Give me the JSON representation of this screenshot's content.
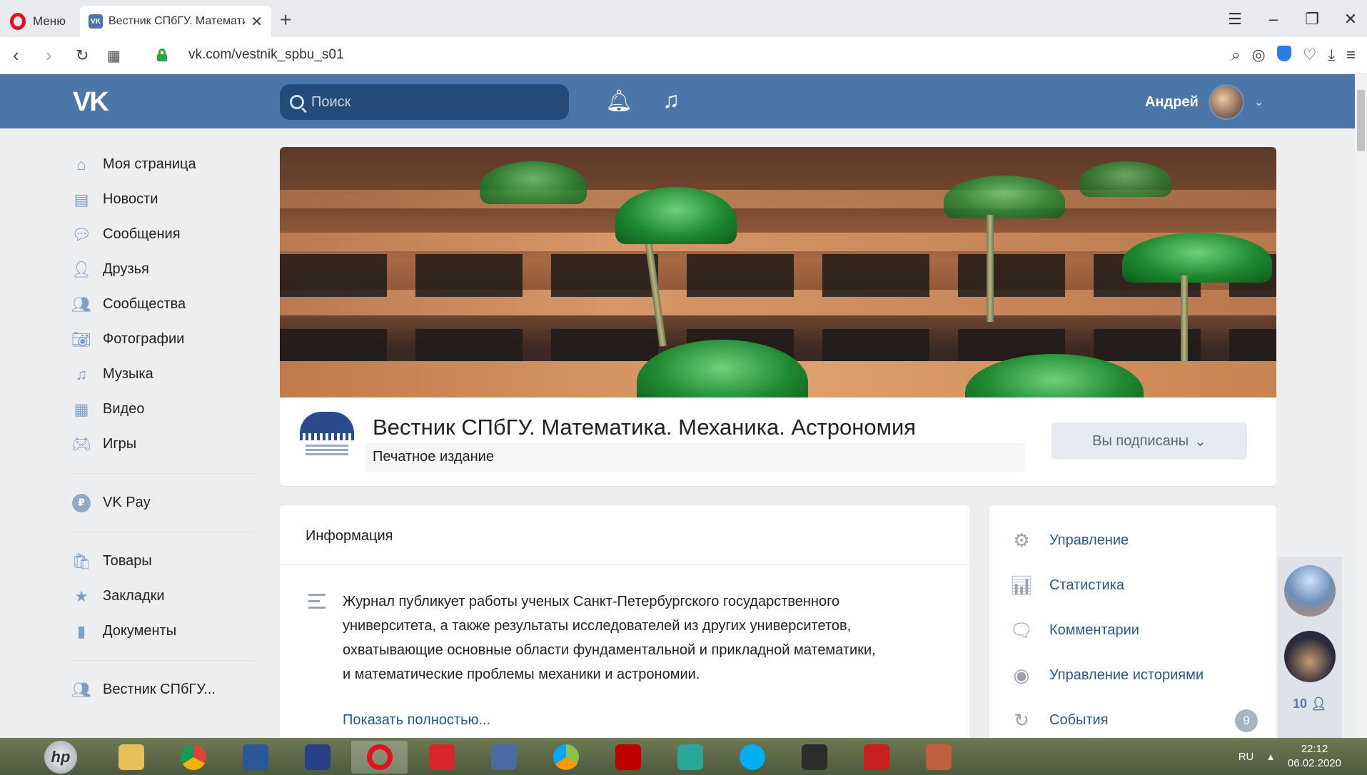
{
  "browser": {
    "menu_label": "Меню",
    "tab_title": "Вестник СПбГУ. Математи",
    "url": "vk.com/vestnik_spbu_s01"
  },
  "header": {
    "search_placeholder": "Поиск",
    "user_name": "Андрей"
  },
  "sidebar": {
    "items": [
      {
        "label": "Моя страница",
        "icon": "home-icon"
      },
      {
        "label": "Новости",
        "icon": "news-icon"
      },
      {
        "label": "Сообщения",
        "icon": "messages-icon"
      },
      {
        "label": "Друзья",
        "icon": "friends-icon"
      },
      {
        "label": "Сообщества",
        "icon": "communities-icon"
      },
      {
        "label": "Фотографии",
        "icon": "photos-icon"
      },
      {
        "label": "Музыка",
        "icon": "music-icon"
      },
      {
        "label": "Видео",
        "icon": "video-icon"
      },
      {
        "label": "Игры",
        "icon": "games-icon"
      },
      {
        "label": "VK Pay",
        "icon": "vkpay-icon"
      },
      {
        "label": "Товары",
        "icon": "goods-icon"
      },
      {
        "label": "Закладки",
        "icon": "bookmarks-icon"
      },
      {
        "label": "Документы",
        "icon": "documents-icon"
      },
      {
        "label": "Вестник СПбГУ...",
        "icon": "group-icon"
      }
    ]
  },
  "group": {
    "title": "Вестник СПбГУ. Математика. Механика. Астрономия",
    "status": "Печатное издание",
    "subscribe_label": "Вы подписаны"
  },
  "info": {
    "heading": "Информация",
    "description": "Журнал публикует работы ученых Санкт-Петербургского государственного университета, а также результаты исследователей из других университетов, охватывающие основные области фундаментальной и прикладной математики, и математические проблемы механики и астрономии.",
    "show_more": "Показать полностью..."
  },
  "management": {
    "items": [
      {
        "label": "Управление",
        "icon": "gear-icon"
      },
      {
        "label": "Статистика",
        "icon": "stats-icon"
      },
      {
        "label": "Комментарии",
        "icon": "comments-icon"
      },
      {
        "label": "Управление историями",
        "icon": "stories-icon"
      },
      {
        "label": "События",
        "icon": "events-icon",
        "badge": "9"
      }
    ]
  },
  "chats": {
    "count": "10"
  },
  "taskbar": {
    "language": "RU",
    "time": "22:12",
    "date": "06.02.2020"
  },
  "colors": {
    "vk_blue": "#4a76a8",
    "link": "#2a5885",
    "background": "#edeef0"
  }
}
